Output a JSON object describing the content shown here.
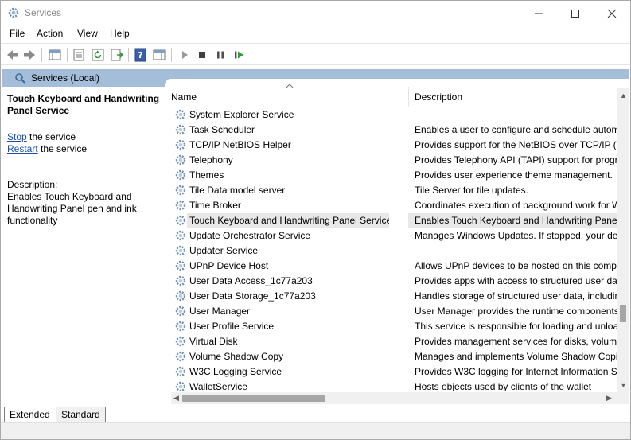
{
  "window": {
    "title": "Services"
  },
  "menu": [
    "File",
    "Action",
    "View",
    "Help"
  ],
  "scope": {
    "title": "Services (Local)"
  },
  "left_pane": {
    "service_title": "Touch Keyboard and Handwriting Panel Service",
    "stop_link": "Stop",
    "stop_suffix": " the service",
    "restart_link": "Restart",
    "restart_suffix": " the service",
    "description_label": "Description:",
    "description": "Enables Touch Keyboard and Handwriting Panel pen and ink functionality"
  },
  "table": {
    "columns": {
      "name": "Name",
      "description": "Description"
    },
    "rows": [
      {
        "name": "System Explorer Service",
        "description": ""
      },
      {
        "name": "Task Scheduler",
        "description": "Enables a user to configure and schedule autom"
      },
      {
        "name": "TCP/IP NetBIOS Helper",
        "description": "Provides support for the NetBIOS over TCP/IP (N"
      },
      {
        "name": "Telephony",
        "description": "Provides Telephony API (TAPI) support for progr"
      },
      {
        "name": "Themes",
        "description": "Provides user experience theme management."
      },
      {
        "name": "Tile Data model server",
        "description": "Tile Server for tile updates."
      },
      {
        "name": "Time Broker",
        "description": "Coordinates execution of background work for W"
      },
      {
        "name": "Touch Keyboard and Handwriting Panel Service",
        "description": "Enables Touch Keyboard and Handwriting Panel"
      },
      {
        "name": "Update Orchestrator Service",
        "description": "Manages Windows Updates. If stopped, your dev"
      },
      {
        "name": "Updater Service",
        "description": ""
      },
      {
        "name": "UPnP Device Host",
        "description": "Allows UPnP devices to be hosted on this compu"
      },
      {
        "name": "User Data Access_1c77a203",
        "description": "Provides apps with access to structured user dat"
      },
      {
        "name": "User Data Storage_1c77a203",
        "description": "Handles storage of structured user data, includin"
      },
      {
        "name": "User Manager",
        "description": "User Manager provides the runtime components"
      },
      {
        "name": "User Profile Service",
        "description": "This service is responsible for loading and unloa"
      },
      {
        "name": "Virtual Disk",
        "description": "Provides management services for disks, volume"
      },
      {
        "name": "Volume Shadow Copy",
        "description": "Manages and implements Volume Shadow Copi"
      },
      {
        "name": "W3C Logging Service",
        "description": "Provides W3C logging for Internet Information S"
      },
      {
        "name": "WalletService",
        "description": "Hosts objects used by clients of the wallet"
      }
    ],
    "selected_index": 7
  },
  "tabs": {
    "extended": "Extended",
    "standard": "Standard"
  },
  "colors": {
    "scope_header": "#a4bdd9",
    "link": "#1d4ea3",
    "selected_row": "#e8e8e8",
    "play_green": "#2f9a3a"
  }
}
